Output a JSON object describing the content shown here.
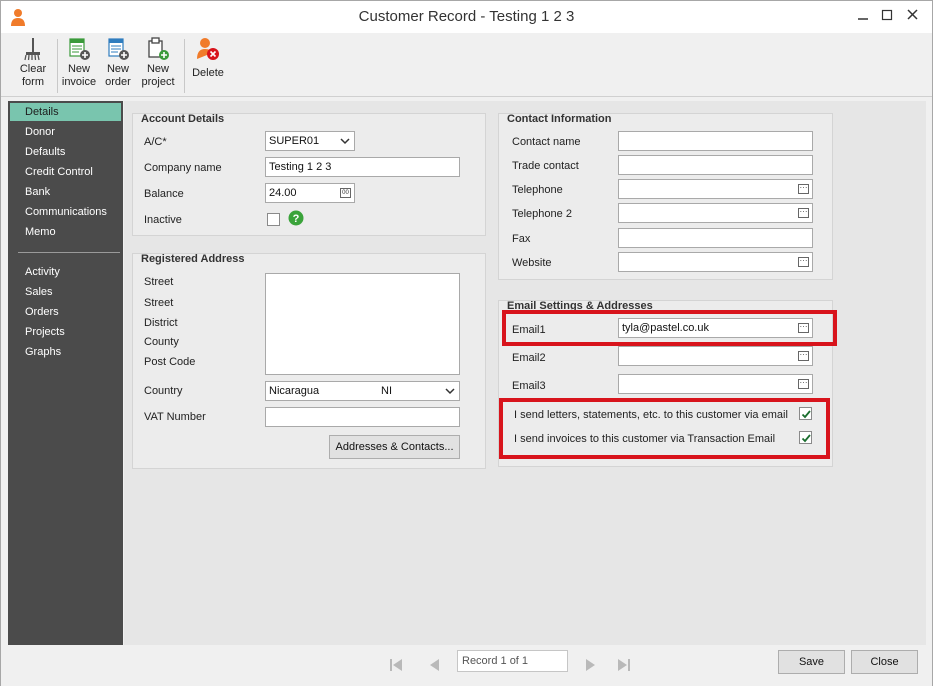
{
  "window": {
    "title": "Customer Record - Testing 1 2 3"
  },
  "toolbar": {
    "clear_form": [
      "Clear",
      "form"
    ],
    "new_invoice": [
      "New",
      "invoice"
    ],
    "new_order": [
      "New",
      "order"
    ],
    "new_project": [
      "New",
      "project"
    ],
    "delete": "Delete"
  },
  "sidebar": {
    "items": [
      "Details",
      "Donor",
      "Defaults",
      "Credit Control",
      "Bank",
      "Communications",
      "Memo"
    ],
    "items2": [
      "Activity",
      "Sales",
      "Orders",
      "Projects",
      "Graphs"
    ],
    "active": "Details"
  },
  "account": {
    "title": "Account Details",
    "ac_label": "A/C*",
    "ac_value": "SUPER01",
    "company_label": "Company name",
    "company_value": "Testing 1 2 3",
    "balance_label": "Balance",
    "balance_value": "24.00",
    "inactive_label": "Inactive",
    "inactive_checked": false
  },
  "address": {
    "title": "Registered Address",
    "street1_label": "Street",
    "street2_label": "Street",
    "district_label": "District",
    "county_label": "County",
    "postcode_label": "Post Code",
    "country_label": "Country",
    "country_name": "Nicaragua",
    "country_code": "NI",
    "vat_label": "VAT Number",
    "vat_value": "",
    "addresses_button": "Addresses & Contacts..."
  },
  "contact": {
    "title": "Contact Information",
    "contact_name_label": "Contact name",
    "trade_contact_label": "Trade contact",
    "telephone_label": "Telephone",
    "telephone2_label": "Telephone 2",
    "fax_label": "Fax",
    "website_label": "Website"
  },
  "email": {
    "title": "Email Settings & Addresses",
    "email1_label": "Email1",
    "email1_value": "tyla@pastel.co.uk",
    "email2_label": "Email2",
    "email2_value": "",
    "email3_label": "Email3",
    "email3_value": "",
    "letters_label": "I send letters, statements, etc. to this customer via email",
    "letters_checked": true,
    "invoices_label": "I send invoices to this customer via Transaction Email",
    "invoices_checked": true
  },
  "footer": {
    "record_text": "Record 1 of 1",
    "save_label": "Save",
    "close_label": "Close"
  },
  "colors": {
    "highlight": "#d8141c",
    "sidebar_active": "#79c5ae",
    "sidebar_bg": "#4b4b4b"
  }
}
